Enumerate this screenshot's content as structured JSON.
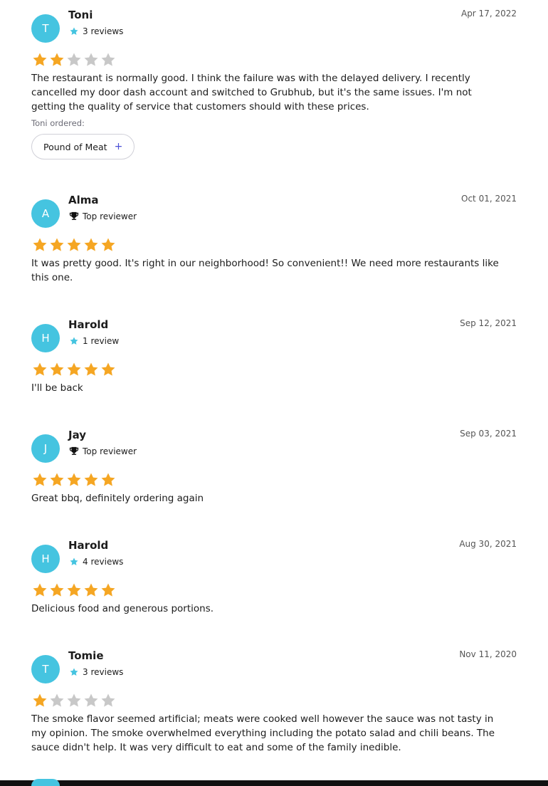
{
  "colors": {
    "avatar_bg": "#45c4e0",
    "star_filled": "#f5a623",
    "star_empty": "#c8c8c8",
    "badge_star": "#45c4e0",
    "add_accent": "#4b4fd6"
  },
  "reviews": [
    {
      "initial": "T",
      "name": "Toni",
      "badge_icon": "star-icon",
      "badge": "3 reviews",
      "date": "Apr 17, 2022",
      "rating": 2,
      "text": "The restaurant is normally good. I think the failure was with the delayed delivery. I recently cancelled my door dash account and switched to Grubhub, but it's the same issues. I'm not getting the quality of service that customers should with these prices.",
      "ordered_label": "Toni ordered:",
      "ordered_item": "Pound of Meat"
    },
    {
      "initial": "A",
      "name": "Alma",
      "badge_icon": "trophy-icon",
      "badge": "Top reviewer",
      "date": "Oct 01, 2021",
      "rating": 5,
      "text": "It was pretty good. It's right in our neighborhood! So convenient!! We need more restaurants like this one."
    },
    {
      "initial": "H",
      "name": "Harold",
      "badge_icon": "star-icon",
      "badge": "1 review",
      "date": "Sep 12, 2021",
      "rating": 5,
      "text": "I'll be back"
    },
    {
      "initial": "J",
      "name": "Jay",
      "badge_icon": "trophy-icon",
      "badge": "Top reviewer",
      "date": "Sep 03, 2021",
      "rating": 5,
      "text": "Great bbq, definitely ordering again"
    },
    {
      "initial": "H",
      "name": "Harold",
      "badge_icon": "star-icon",
      "badge": "4 reviews",
      "date": "Aug 30, 2021",
      "rating": 5,
      "text": "Delicious food and generous portions."
    },
    {
      "initial": "T",
      "name": "Tomie",
      "badge_icon": "star-icon",
      "badge": "3 reviews",
      "date": "Nov 11, 2020",
      "rating": 1,
      "text": "The smoke flavor seemed artificial; meats were cooked well however the sauce was not tasty in my opinion. The smoke overwhelmed everything including the potato salad and chili beans. The sauce didn't help. It was very difficult to eat and some of the family inedible."
    }
  ]
}
